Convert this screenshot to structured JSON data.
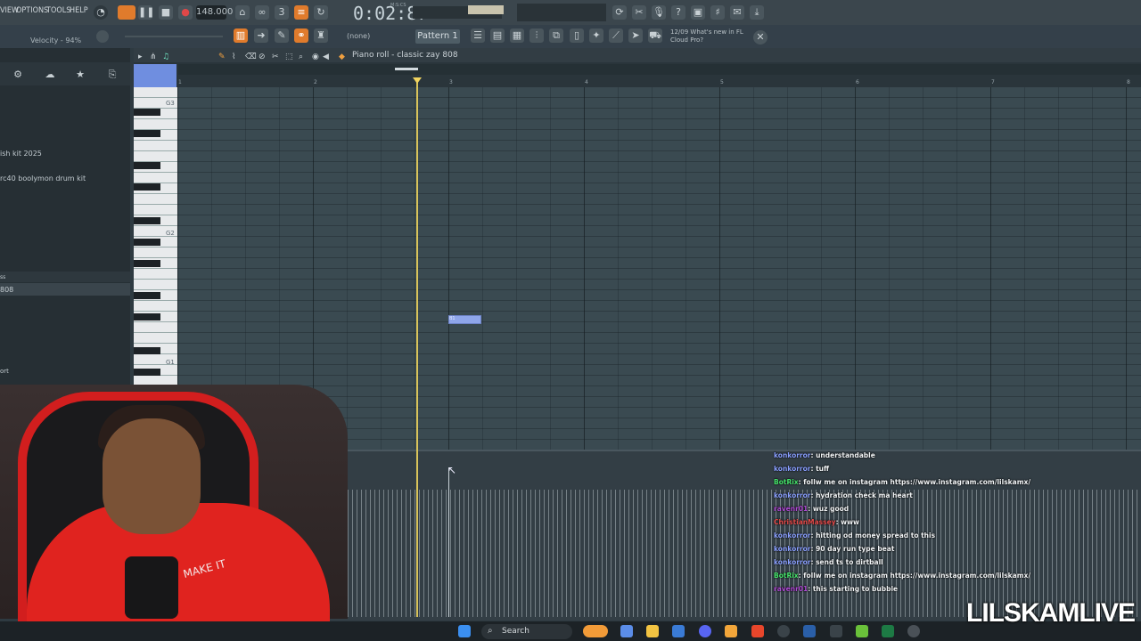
{
  "app": {
    "menu": [
      "VIEW",
      "OPTIONS",
      "TOOLS",
      "HELP"
    ],
    "tempo": "148.000",
    "time": "0:02:87",
    "time_unit": "M:S:CS",
    "pattern": "Pattern 1",
    "none_selector": "(none)",
    "velocity": "Velocity - 94%",
    "news": "12/09  What's new in FL Cloud Pro?"
  },
  "browser": {
    "items": [
      {
        "label": "ish kit 2025"
      },
      {
        "label": "rc40 boolymon drum kit"
      },
      {
        "label": "ss"
      },
      {
        "label": "808"
      },
      {
        "label": "ort"
      }
    ]
  },
  "piano_roll": {
    "title": "Piano roll - classic zay 808",
    "bar_numbers": [
      "1",
      "2",
      "3",
      "4",
      "5",
      "6",
      "7",
      "8"
    ],
    "key_labels": [
      "G3",
      "G2",
      "G1"
    ],
    "note_label": "B1"
  },
  "chat": [
    {
      "user": "konkorror",
      "text": ": understandable",
      "color": "u"
    },
    {
      "user": "konkorror",
      "text": ": tuff",
      "color": "u"
    },
    {
      "user": "BotRix",
      "text": ": follw me on instagram https://www.instagram.com/lilskamx/",
      "color": "u2"
    },
    {
      "user": "konkorror",
      "text": ": hydration check ma heart",
      "color": "u"
    },
    {
      "user": "ravenr01",
      "text": ": wuz good",
      "color": "u3"
    },
    {
      "user": "ChristianMassey",
      "text": ": www",
      "color": "u4"
    },
    {
      "user": "konkorror",
      "text": ": hitting od money spread to this",
      "color": "u"
    },
    {
      "user": "konkorror",
      "text": ": 90 day run type beat",
      "color": "u"
    },
    {
      "user": "konkorror",
      "text": ": send ts to dirtball",
      "color": "u"
    },
    {
      "user": "BotRix",
      "text": ": follw me on instagram https://www.instagram.com/lilskamx/",
      "color": "u2"
    },
    {
      "user": "ravenr01",
      "text": ": this starting to bubble",
      "color": "u3"
    }
  ],
  "webcam": {
    "hoodie_text": "MAKE IT"
  },
  "taskbar": {
    "search": "Search"
  },
  "watermark": "LILSKAMLIVE",
  "colors": {
    "playhead": "#d8c35a",
    "note": "#8fa6ea",
    "accent": "#f2a63a"
  }
}
